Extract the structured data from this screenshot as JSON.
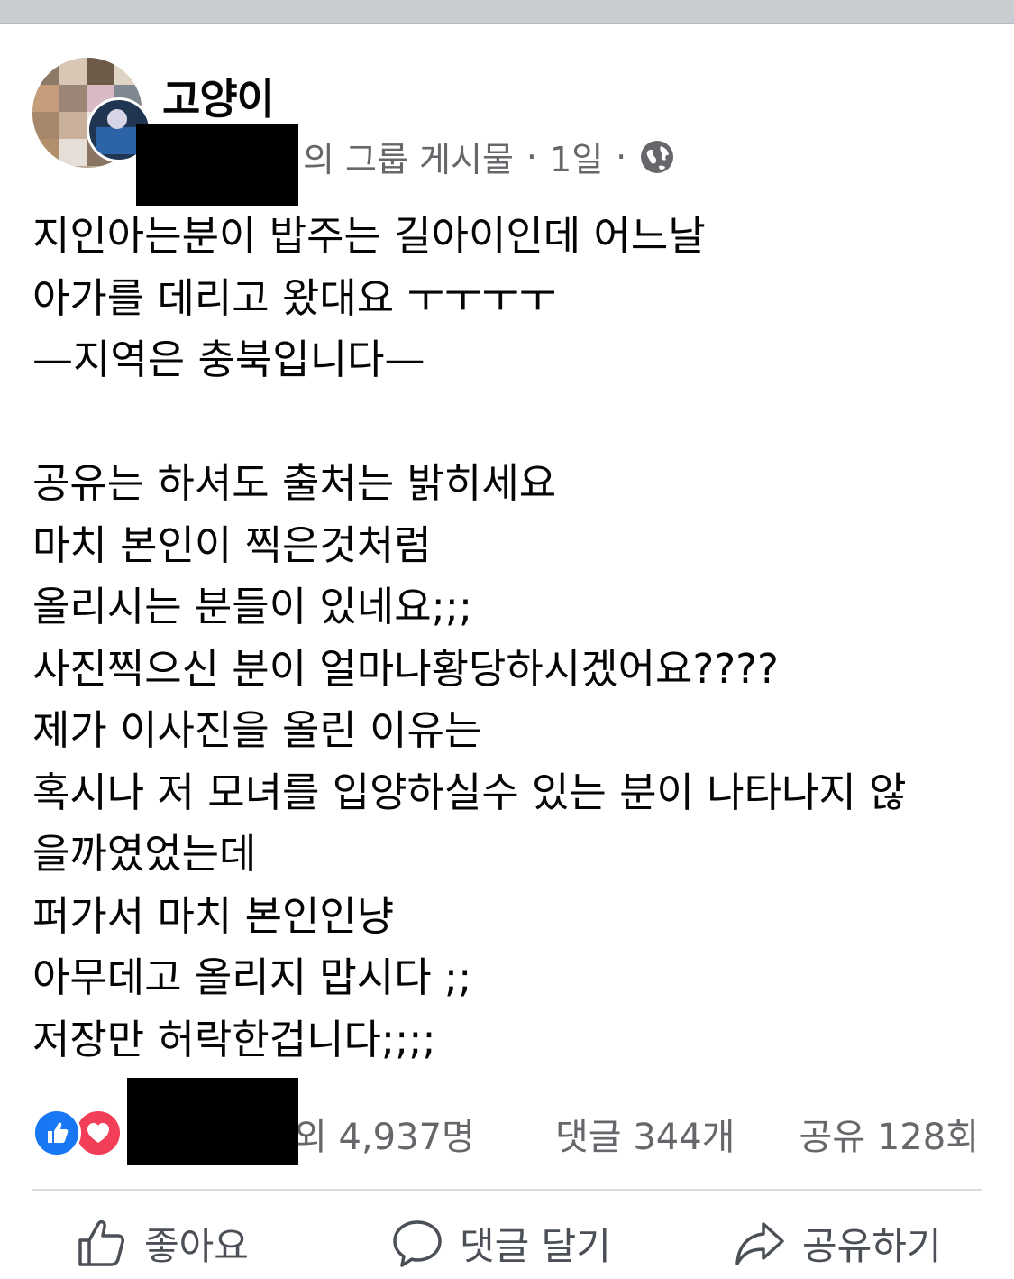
{
  "post": {
    "author": "고양이",
    "meta": {
      "group_suffix": "의 그룹 게시물",
      "sep": "·",
      "time": "1일",
      "privacy_icon": "globe-icon"
    },
    "lines": [
      "지인아는분이 밥주는 길아이인데 어느날",
      "아가를 데리고 왔대요 ㅜㅜㅜㅜ",
      "—지역은 충북입니다—",
      "",
      "공유는 하셔도 출처는 밝히세요",
      "마치 본인이 찍은것처럼",
      "올리시는 분들이 있네요;;;",
      "사진찍으신 분이 얼마나황당하시겠어요????",
      "제가 이사진을 올린 이유는",
      "혹시나 저 모녀를 입양하실수 있는 분이 나타나지 않",
      "을까였었는데",
      "퍼가서 마치 본인인냥",
      "아무데고 올리지 맙시다 ;;",
      "저장만 허락한겁니다;;;;"
    ]
  },
  "stats": {
    "reaction_icons": [
      "like-icon",
      "love-icon"
    ],
    "reactions": "외 4,937명",
    "comments": "댓글 344개",
    "shares": "공유 128회"
  },
  "actions": {
    "like": "좋아요",
    "comment": "댓글 달기",
    "share": "공유하기"
  },
  "colors": {
    "like_blue": "#1877f2",
    "love_red": "#f33e58",
    "meta_gray": "#65676b"
  }
}
